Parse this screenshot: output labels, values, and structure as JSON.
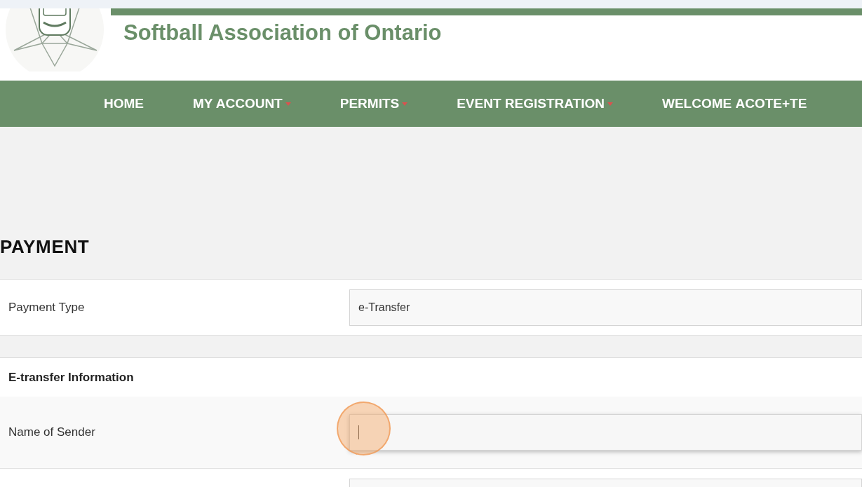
{
  "header": {
    "title": "Softball Association of Ontario"
  },
  "nav": [
    {
      "label": "HOME",
      "dropdown": false
    },
    {
      "label": "MY ACCOUNT",
      "dropdown": true
    },
    {
      "label": "PERMITS",
      "dropdown": true
    },
    {
      "label": "EVENT REGISTRATION",
      "dropdown": true
    },
    {
      "label": "WELCOME **ACOTE+TE**",
      "dropdown": false
    }
  ],
  "page_title": "PAYMENT",
  "form": [
    {
      "kind": "field",
      "label": "Payment Type",
      "value": "e-Transfer",
      "focused": false
    },
    {
      "kind": "gap"
    },
    {
      "kind": "section",
      "label": "E-transfer Information"
    },
    {
      "kind": "field",
      "label": "Name of Sender",
      "focused": true
    },
    {
      "kind": "field",
      "focused": false
    }
  ]
}
